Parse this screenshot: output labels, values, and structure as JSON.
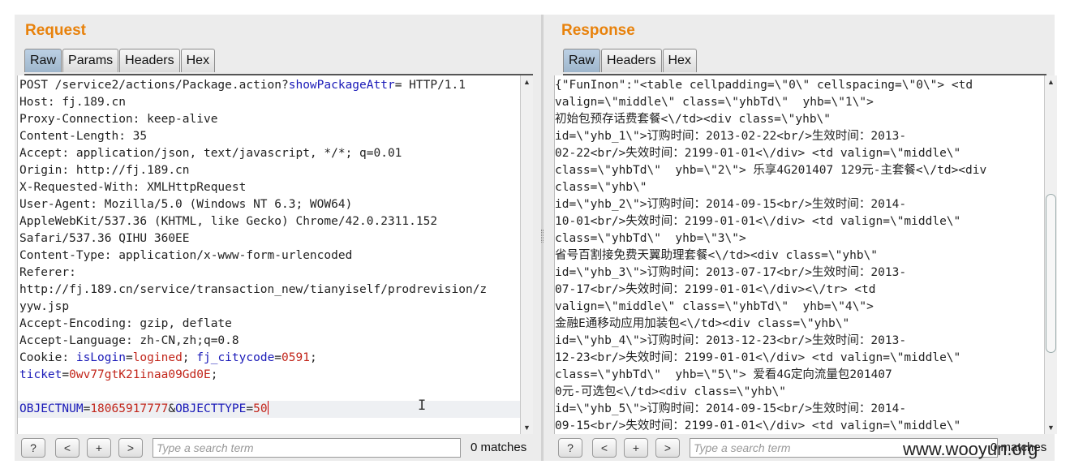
{
  "request": {
    "title": "Request",
    "tabs": [
      "Raw",
      "Params",
      "Headers",
      "Hex"
    ],
    "active_tab": "Raw",
    "lines": [
      "POST /service2/actions/Package.action?",
      "Host: fj.189.cn",
      "Proxy-Connection: keep-alive",
      "Content-Length: 35",
      "Accept: application/json, text/javascript, */*; q=0.01",
      "Origin: http://fj.189.cn",
      "X-Requested-With: XMLHttpRequest",
      "User-Agent: Mozilla/5.0 (Windows NT 6.3; WOW64)",
      "AppleWebKit/537.36 (KHTML, like Gecko) Chrome/42.0.2311.152",
      "Safari/537.36 QIHU 360EE",
      "Content-Type: application/x-www-form-urlencoded",
      "Referer:",
      "http://fj.189.cn/service/transaction_new/tianyiself/prodrevision/z",
      "yyw.jsp",
      "Accept-Encoding: gzip, deflate",
      "Accept-Language: zh-CN,zh;q=0.8",
      "Cookie: "
    ],
    "line1_param_key": "showPackageAttr",
    "line1_suffix": "= HTTP/1.1",
    "cookie": {
      "k1": "isLogin",
      "v1": "logined",
      "k2": "fj_citycode",
      "v2": "0591",
      "k3": "ticket",
      "v3": "0wv77gtK21inaa09Gd0E",
      "sep": "=",
      "semi": "; ",
      "end": ";"
    },
    "body": {
      "k1": "OBJECTNUM",
      "v1": "18065917777",
      "amp": "&",
      "k2": "OBJECTTYPE",
      "v2": "50",
      "eq": "="
    },
    "search_placeholder": "Type a search term",
    "matches": "0 matches",
    "buttons": {
      "help": "?",
      "prev": "<",
      "add": "+",
      "next": ">"
    }
  },
  "response": {
    "title": "Response",
    "tabs": [
      "Raw",
      "Headers",
      "Hex"
    ],
    "active_tab": "Raw",
    "lines": [
      "{\"FunInon\":\"<table cellpadding=\\\"0\\\" cellspacing=\\\"0\\\"> <td",
      "valign=\\\"middle\\\" class=\\\"yhbTd\\\"  yhb=\\\"1\\\">",
      "初始包预存话费套餐<\\/td><div class=\\\"yhb\\\"",
      "id=\\\"yhb_1\\\">订购时间：2013-02-22<br/>生效时间：2013-",
      "02-22<br/>失效时间：2199-01-01<\\/div> <td valign=\\\"middle\\\"",
      "class=\\\"yhbTd\\\"  yhb=\\\"2\\\"> 乐享4G201407 129元-主套餐<\\/td><div",
      "class=\\\"yhb\\\"",
      "id=\\\"yhb_2\\\">订购时间：2014-09-15<br/>生效时间：2014-",
      "10-01<br/>失效时间：2199-01-01<\\/div> <td valign=\\\"middle\\\"",
      "class=\\\"yhbTd\\\"  yhb=\\\"3\\\">",
      "省号百割接免费天翼助理套餐<\\/td><div class=\\\"yhb\\\"",
      "id=\\\"yhb_3\\\">订购时间：2013-07-17<br/>生效时间：2013-",
      "07-17<br/>失效时间：2199-01-01<\\/div><\\/tr> <td",
      "valign=\\\"middle\\\" class=\\\"yhbTd\\\"  yhb=\\\"4\\\">",
      "金融E通移动应用加装包<\\/td><div class=\\\"yhb\\\"",
      "id=\\\"yhb_4\\\">订购时间：2013-12-23<br/>生效时间：2013-",
      "12-23<br/>失效时间：2199-01-01<\\/div> <td valign=\\\"middle\\\"",
      "class=\\\"yhbTd\\\"  yhb=\\\"5\\\"> 爱看4G定向流量包201407",
      "0元-可选包<\\/td><div class=\\\"yhb\\\"",
      "id=\\\"yhb_5\\\">订购时间：2014-09-15<br/>生效时间：2014-",
      "09-15<br/>失效时间：2199-01-01<\\/div> <td valign=\\\"middle\\\""
    ],
    "search_placeholder": "Type a search term",
    "matches": "0 matches",
    "buttons": {
      "help": "?",
      "prev": "<",
      "add": "+",
      "next": ">"
    }
  },
  "watermark": "www.wooyun.org",
  "colors": {
    "title": "#e8820c",
    "param_key": "#1a1ab8",
    "param_value": "#c2261b"
  }
}
